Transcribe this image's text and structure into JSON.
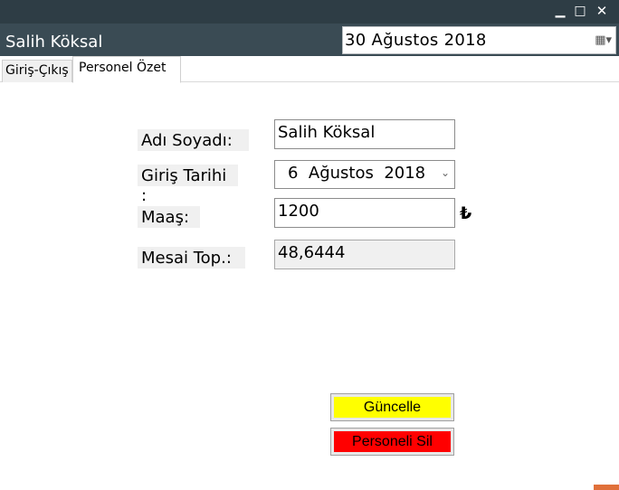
{
  "window": {
    "title": "Salih Köksal",
    "controls": {
      "minimize": "▁",
      "maximize": "□",
      "close": "✕"
    }
  },
  "header": {
    "date_value": "30 Ağustos 2018",
    "calendar_icon": "calendar-icon"
  },
  "tabs": [
    {
      "label": "Giriş-Çıkış",
      "active": false
    },
    {
      "label": "Personel Özet",
      "active": true
    }
  ],
  "form": {
    "name_label": "Adı Soyadı:",
    "name_value": "Salih Köksal",
    "start_date_label": "Giriş Tarihi :",
    "start_date_value": "6  Ağustos  2018",
    "salary_label": "Maaş:",
    "salary_value": "1200",
    "currency_symbol": "₺",
    "overtime_label": "Mesai Top.:",
    "overtime_value": "48,6444"
  },
  "buttons": {
    "update_label": "Güncelle",
    "delete_label": "Personeli Sil"
  },
  "colors": {
    "titlebar": "#2e3d45",
    "update_button": "#ffff00",
    "delete_button": "#ff0000"
  }
}
